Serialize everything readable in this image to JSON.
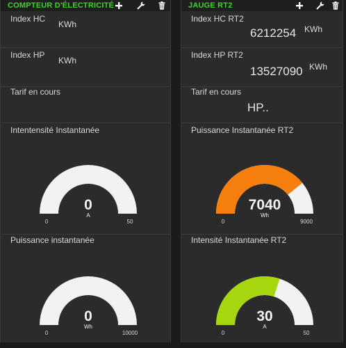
{
  "left_panel": {
    "title": "COMPTEUR D'ÉLECTRICITÉ",
    "rows": [
      {
        "label": "Index HC",
        "value": "",
        "unit": "KWh"
      },
      {
        "label": "Index HP",
        "value": "",
        "unit": "KWh"
      },
      {
        "label": "Tarif en cours",
        "value": ""
      }
    ],
    "gauges": [
      {
        "label": "Intentensité Instantanée",
        "value": "0",
        "unit": "A",
        "min": "0",
        "max": "50",
        "fraction": 0.0,
        "color": "#f2f2f2"
      },
      {
        "label": "Puissance instantanée",
        "value": "0",
        "unit": "Wh",
        "min": "0",
        "max": "10000",
        "fraction": 0.0,
        "color": "#f2f2f2"
      }
    ]
  },
  "right_panel": {
    "title": "JAUGE RT2",
    "rows": [
      {
        "label": "Index HC RT2",
        "value": "6212254",
        "unit": "KWh"
      },
      {
        "label": "Index HP RT2",
        "value": "13527090",
        "unit": "KWh"
      },
      {
        "label": "Tarif en cours",
        "value": "HP.."
      }
    ],
    "gauges": [
      {
        "label": "Puissance Instantanée RT2",
        "value": "7040",
        "unit": "Wh",
        "min": "0",
        "max": "9000",
        "fraction": 0.782,
        "color": "#f77f0e"
      },
      {
        "label": "Intensité Instantanée RT2",
        "value": "30",
        "unit": "A",
        "min": "0",
        "max": "50",
        "fraction": 0.6,
        "color": "#a6d60d"
      }
    ]
  },
  "icons": {
    "add": "plus-icon",
    "settings": "wrench-icon",
    "delete": "trash-icon"
  },
  "colors": {
    "title": "#3fd12a",
    "gauge_track": "#f2f2f2",
    "orange": "#f77f0e",
    "green": "#a6d60d"
  }
}
